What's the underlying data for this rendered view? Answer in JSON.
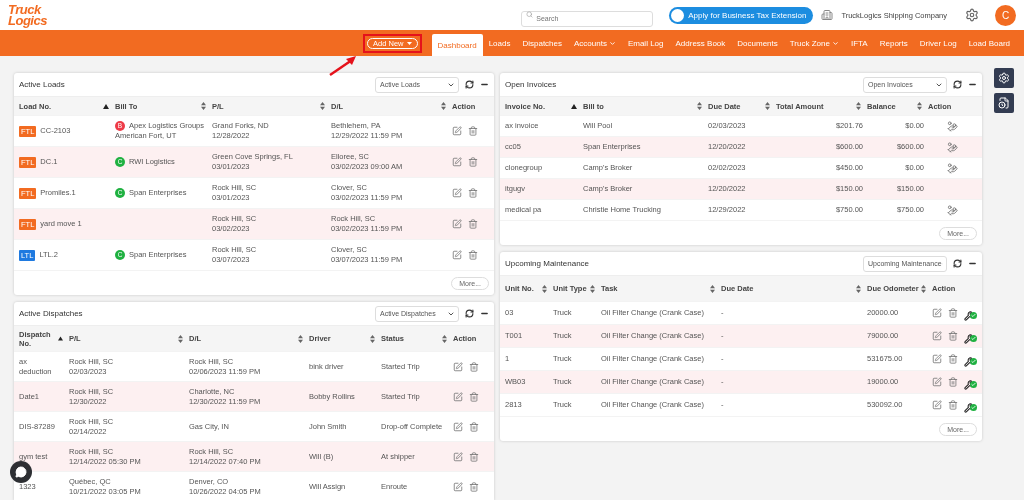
{
  "header": {
    "logo": {
      "line1": "Truck",
      "line2": "Logics"
    },
    "search": {
      "placeholder": "Search"
    },
    "promo_button": "Apply for Business Tax Extension",
    "company": "TruckLogics Shipping Company",
    "avatar": "C"
  },
  "nav": {
    "add_new": "Add New",
    "items": [
      {
        "label": "Dashboard",
        "selected": true,
        "kind": "link"
      },
      {
        "label": "Loads",
        "selected": false,
        "kind": "link"
      },
      {
        "label": "Dispatches",
        "selected": false,
        "kind": "link"
      },
      {
        "label": "Accounts",
        "selected": false,
        "kind": "dropdown"
      },
      {
        "label": "Email Log",
        "selected": false,
        "kind": "link"
      },
      {
        "label": "Address Book",
        "selected": false,
        "kind": "link"
      },
      {
        "label": "Documents",
        "selected": false,
        "kind": "link"
      },
      {
        "label": "Truck Zone",
        "selected": false,
        "kind": "dropdown"
      },
      {
        "label": "IFTA",
        "selected": false,
        "kind": "link"
      },
      {
        "label": "Reports",
        "selected": false,
        "kind": "link"
      },
      {
        "label": "Driver Log",
        "selected": false,
        "kind": "link"
      },
      {
        "label": "Load Board",
        "selected": false,
        "kind": "link"
      }
    ]
  },
  "active_loads": {
    "title": "Active Loads",
    "filter": "Active Loads",
    "columns": [
      {
        "label": "Load No.",
        "sortable": true,
        "sorted": true
      },
      {
        "label": "Bill To",
        "sortable": true,
        "sorted": false
      },
      {
        "label": "P/L",
        "sortable": true,
        "sorted": false
      },
      {
        "label": "D/L",
        "sortable": true,
        "sorted": false
      },
      {
        "label": "Action",
        "sortable": false
      }
    ],
    "rows": [
      {
        "type": {
          "label": "FTL",
          "color": "#f26b21"
        },
        "load_no": "CC-2103",
        "bill_to": {
          "initial": "B",
          "color": "#ee3b48",
          "name": "Apex Logistics Groups",
          "location": "American Fort, UT"
        },
        "pl": {
          "place": "Grand Forks, ND",
          "date": "12/28/2022"
        },
        "dl": {
          "place": "Bethlehem, PA",
          "date": "12/29/2022 11:59 PM"
        }
      },
      {
        "type": {
          "label": "FTL",
          "color": "#f26b21"
        },
        "load_no": "DC.1",
        "bill_to": {
          "initial": "C",
          "color": "#1fb141",
          "name": "RWI Logistics"
        },
        "pl": {
          "place": "Green Cove Springs, FL",
          "date": "03/01/2023"
        },
        "dl": {
          "place": "Elloree, SC",
          "date": "03/02/2023 09:00 AM"
        }
      },
      {
        "type": {
          "label": "FTL",
          "color": "#f26b21"
        },
        "load_no": "Promiles.1",
        "bill_to": {
          "initial": "C",
          "color": "#1fb141",
          "name": "Span Enterprises"
        },
        "pl": {
          "place": "Rock Hill, SC",
          "date": "03/01/2023"
        },
        "dl": {
          "place": "Clover, SC",
          "date": "03/02/2023 11:59 PM"
        }
      },
      {
        "type": {
          "label": "FTL",
          "color": "#f26b21"
        },
        "load_no": "yard move 1",
        "pl": {
          "place": "Rock Hill, SC",
          "date": "03/02/2023"
        },
        "dl": {
          "place": "Rock Hill, SC",
          "date": "03/02/2023 11:59 PM"
        }
      },
      {
        "type": {
          "label": "LTL",
          "color": "#1f7ae0"
        },
        "load_no": "LTL.2",
        "bill_to": {
          "initial": "C",
          "color": "#1fb141",
          "name": "Span Enterprises"
        },
        "pl": {
          "place": "Rock Hill, SC",
          "date": "03/07/2023"
        },
        "dl": {
          "place": "Clover, SC",
          "date": "03/07/2023 11:59 PM"
        }
      }
    ],
    "more": "More..."
  },
  "active_dispatches": {
    "title": "Active Dispatches",
    "filter": "Active Dispatches",
    "columns": [
      {
        "label": "Dispatch No.",
        "sortable": true,
        "sorted": true
      },
      {
        "label": "P/L",
        "sortable": true,
        "sorted": false
      },
      {
        "label": "D/L",
        "sortable": true,
        "sorted": false
      },
      {
        "label": "Driver",
        "sortable": true,
        "sorted": false
      },
      {
        "label": "Status",
        "sortable": true,
        "sorted": false
      },
      {
        "label": "Action",
        "sortable": false
      }
    ],
    "rows": [
      {
        "dispatch_no": "ax deduction",
        "pl": {
          "place": "Rock Hill, SC",
          "date": "02/03/2023"
        },
        "dl": {
          "place": "Rock Hill, SC",
          "date": "02/06/2023 11:59 PM"
        },
        "driver": "bink driver",
        "status": "Started Trip"
      },
      {
        "dispatch_no": "Date1",
        "pl": {
          "place": "Rock Hill, SC",
          "date": "12/30/2022"
        },
        "dl": {
          "place": "Charlotte, NC",
          "date": "12/30/2022 11:59 PM"
        },
        "driver": "Bobby Rollins",
        "status": "Started Trip"
      },
      {
        "dispatch_no": "DIS-87289",
        "pl": {
          "place": "Rock Hill, SC",
          "date": "02/14/2022"
        },
        "dl": {
          "place": "Gas City, IN"
        },
        "driver": "John Smith",
        "status": "Drop-off Complete"
      },
      {
        "dispatch_no": "gym test",
        "pl": {
          "place": "Rock Hill, SC",
          "date": "12/14/2022 05:30 PM"
        },
        "dl": {
          "place": "Rock Hill, SC",
          "date": "12/14/2022 07:40 PM"
        },
        "driver": "Will (B)",
        "status": "At shipper"
      },
      {
        "dispatch_no": "1323",
        "pl": {
          "place": "Québec, QC",
          "date": "10/21/2022 03:05 PM"
        },
        "dl": {
          "place": "Denver, CO",
          "date": "10/26/2022 04:05 PM"
        },
        "driver": "Will Assign",
        "status": "Enroute"
      }
    ]
  },
  "open_invoices": {
    "title": "Open Invoices",
    "filter": "Open Invoices",
    "columns": [
      {
        "label": "Invoice No.",
        "sortable": true,
        "sorted": true
      },
      {
        "label": "Bill to",
        "sortable": true,
        "sorted": false
      },
      {
        "label": "Due Date",
        "sortable": true,
        "sorted": false
      },
      {
        "label": "Total Amount",
        "sortable": true,
        "sorted": false
      },
      {
        "label": "Balance",
        "sortable": true,
        "sorted": false
      },
      {
        "label": "Action",
        "sortable": false
      }
    ],
    "rows": [
      {
        "invoice_no": "ax invoice",
        "bill_to": "Will Pool",
        "due_date": "02/03/2023",
        "total": "$201.76",
        "balance": "$0.00",
        "payable": true
      },
      {
        "invoice_no": "cc05",
        "bill_to": "Span Enterprises",
        "due_date": "12/20/2022",
        "total": "$600.00",
        "balance": "$600.00",
        "payable": true
      },
      {
        "invoice_no": "clonegroup",
        "bill_to": "Camp's Broker",
        "due_date": "02/02/2023",
        "total": "$450.00",
        "balance": "$0.00",
        "payable": true
      },
      {
        "invoice_no": "itgugv",
        "bill_to": "Camp's Broker",
        "due_date": "12/20/2022",
        "total": "$150.00",
        "balance": "$150.00",
        "payable": false
      },
      {
        "invoice_no": "medical pa",
        "bill_to": "Christie Home Trucking",
        "due_date": "12/29/2022",
        "total": "$750.00",
        "balance": "$750.00",
        "payable": true
      }
    ],
    "more": "More..."
  },
  "upcoming_maintenance": {
    "title": "Upcoming Maintenance",
    "filter": "Upcoming Maintenance",
    "columns": [
      {
        "label": "Unit No.",
        "sortable": true,
        "sorted": false
      },
      {
        "label": "Unit Type",
        "sortable": true,
        "sorted": false
      },
      {
        "label": "Task",
        "sortable": true,
        "sorted": false
      },
      {
        "label": "Due Date",
        "sortable": true,
        "sorted": false
      },
      {
        "label": "Due Odometer",
        "sortable": true,
        "sorted": false
      },
      {
        "label": "Action",
        "sortable": false
      }
    ],
    "rows": [
      {
        "unit_no": "03",
        "unit_type": "Truck",
        "task": "Oil Filter Change (Crank Case)",
        "due_date": "-",
        "odometer": "20000.00"
      },
      {
        "unit_no": "T001",
        "unit_type": "Truck",
        "task": "Oil Filter Change (Crank Case)",
        "due_date": "-",
        "odometer": "79000.00"
      },
      {
        "unit_no": "1",
        "unit_type": "Truck",
        "task": "Oil Filter Change (Crank Case)",
        "due_date": "-",
        "odometer": "531675.00"
      },
      {
        "unit_no": "WB03",
        "unit_type": "Truck",
        "task": "Oil Filter Change (Crank Case)",
        "due_date": "-",
        "odometer": "19000.00"
      },
      {
        "unit_no": "2813",
        "unit_type": "Truck",
        "task": "Oil Filter Change (Crank Case)",
        "due_date": "-",
        "odometer": "530092.00"
      }
    ],
    "more": "More..."
  }
}
